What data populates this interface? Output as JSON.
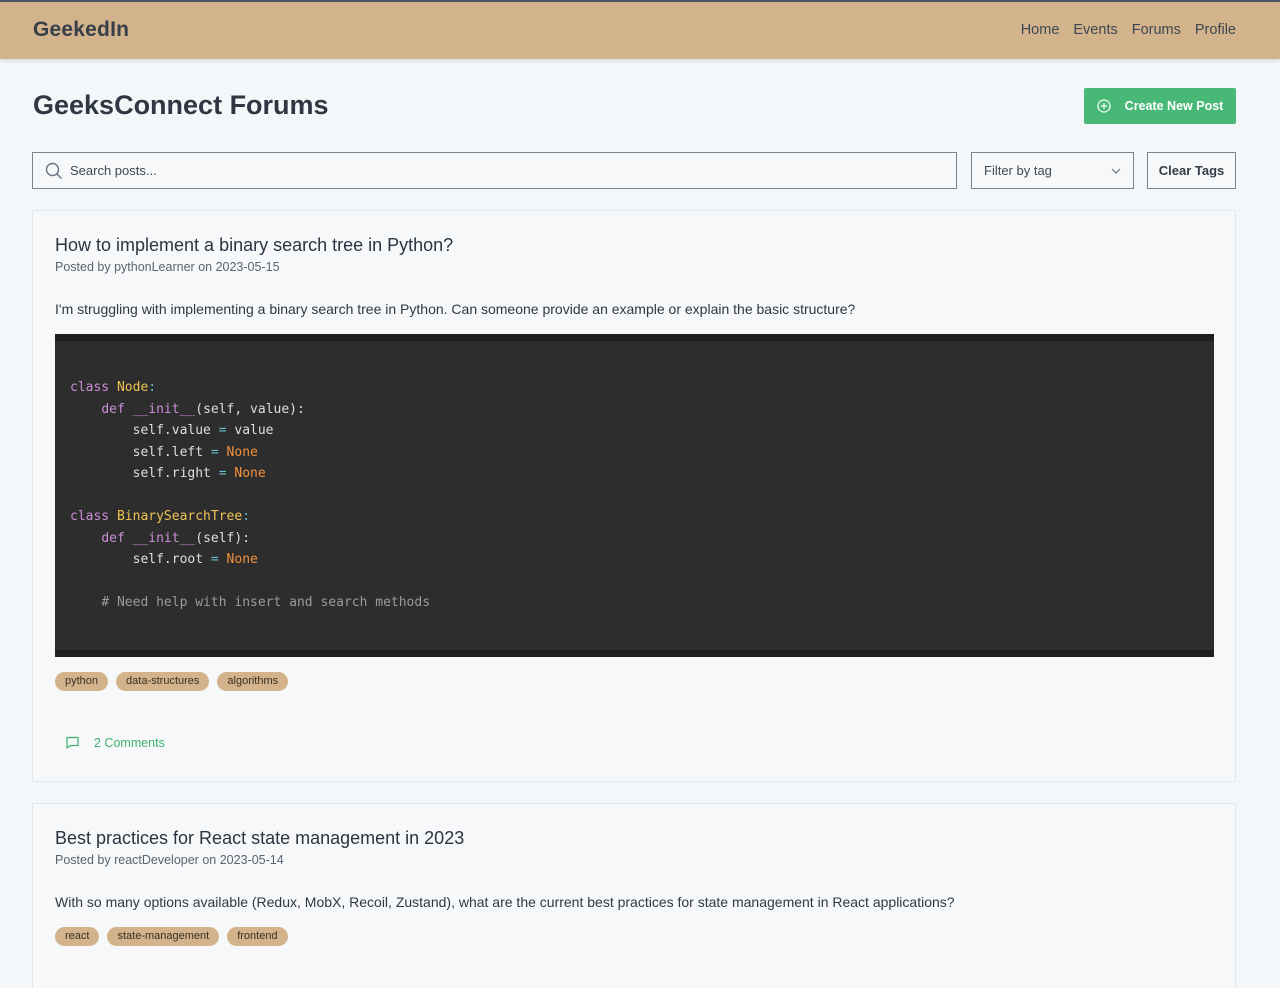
{
  "navbar": {
    "brand": "GeekedIn",
    "links": [
      "Home",
      "Events",
      "Forums",
      "Profile"
    ]
  },
  "page": {
    "title": "GeeksConnect Forums",
    "create_button": "Create New Post",
    "create_icon": "plus-circle-icon"
  },
  "toolbar": {
    "search_placeholder": "Search posts...",
    "filter_label": "Filter by tag",
    "clear_label": "Clear Tags"
  },
  "posts": [
    {
      "title": "How to implement a binary search tree in Python?",
      "posted_by": "Posted by",
      "author": "pythonLearner",
      "on": "on",
      "date": "2023-05-15",
      "body": "I'm struggling with implementing a binary search tree in Python. Can someone provide an example or explain the basic structure?",
      "code": [
        "class Node:",
        "    def __init__(self, value):",
        "        self.value = value",
        "        self.left = None",
        "        self.right = None",
        "",
        "class BinarySearchTree:",
        "    def __init__(self):",
        "        self.root = None",
        "",
        "    # Need help with insert and search methods"
      ],
      "tags": [
        "python",
        "data-structures",
        "algorithms"
      ],
      "comments_label": "2 Comments"
    },
    {
      "title": "Best practices for React state management in 2023",
      "posted_by": "Posted by",
      "author": "reactDeveloper",
      "on": "on",
      "date": "2023-05-14",
      "body": "With so many options available (Redux, MobX, Recoil, Zustand), what are the current best practices for state management in React applications?",
      "tags": [
        "react",
        "state-management",
        "frontend"
      ]
    }
  ],
  "colors": {
    "navbar": "#d3b38b",
    "accent_green": "#48b877",
    "tag_bg": "#d3b38b",
    "code_bg": "#2d2d2d"
  }
}
